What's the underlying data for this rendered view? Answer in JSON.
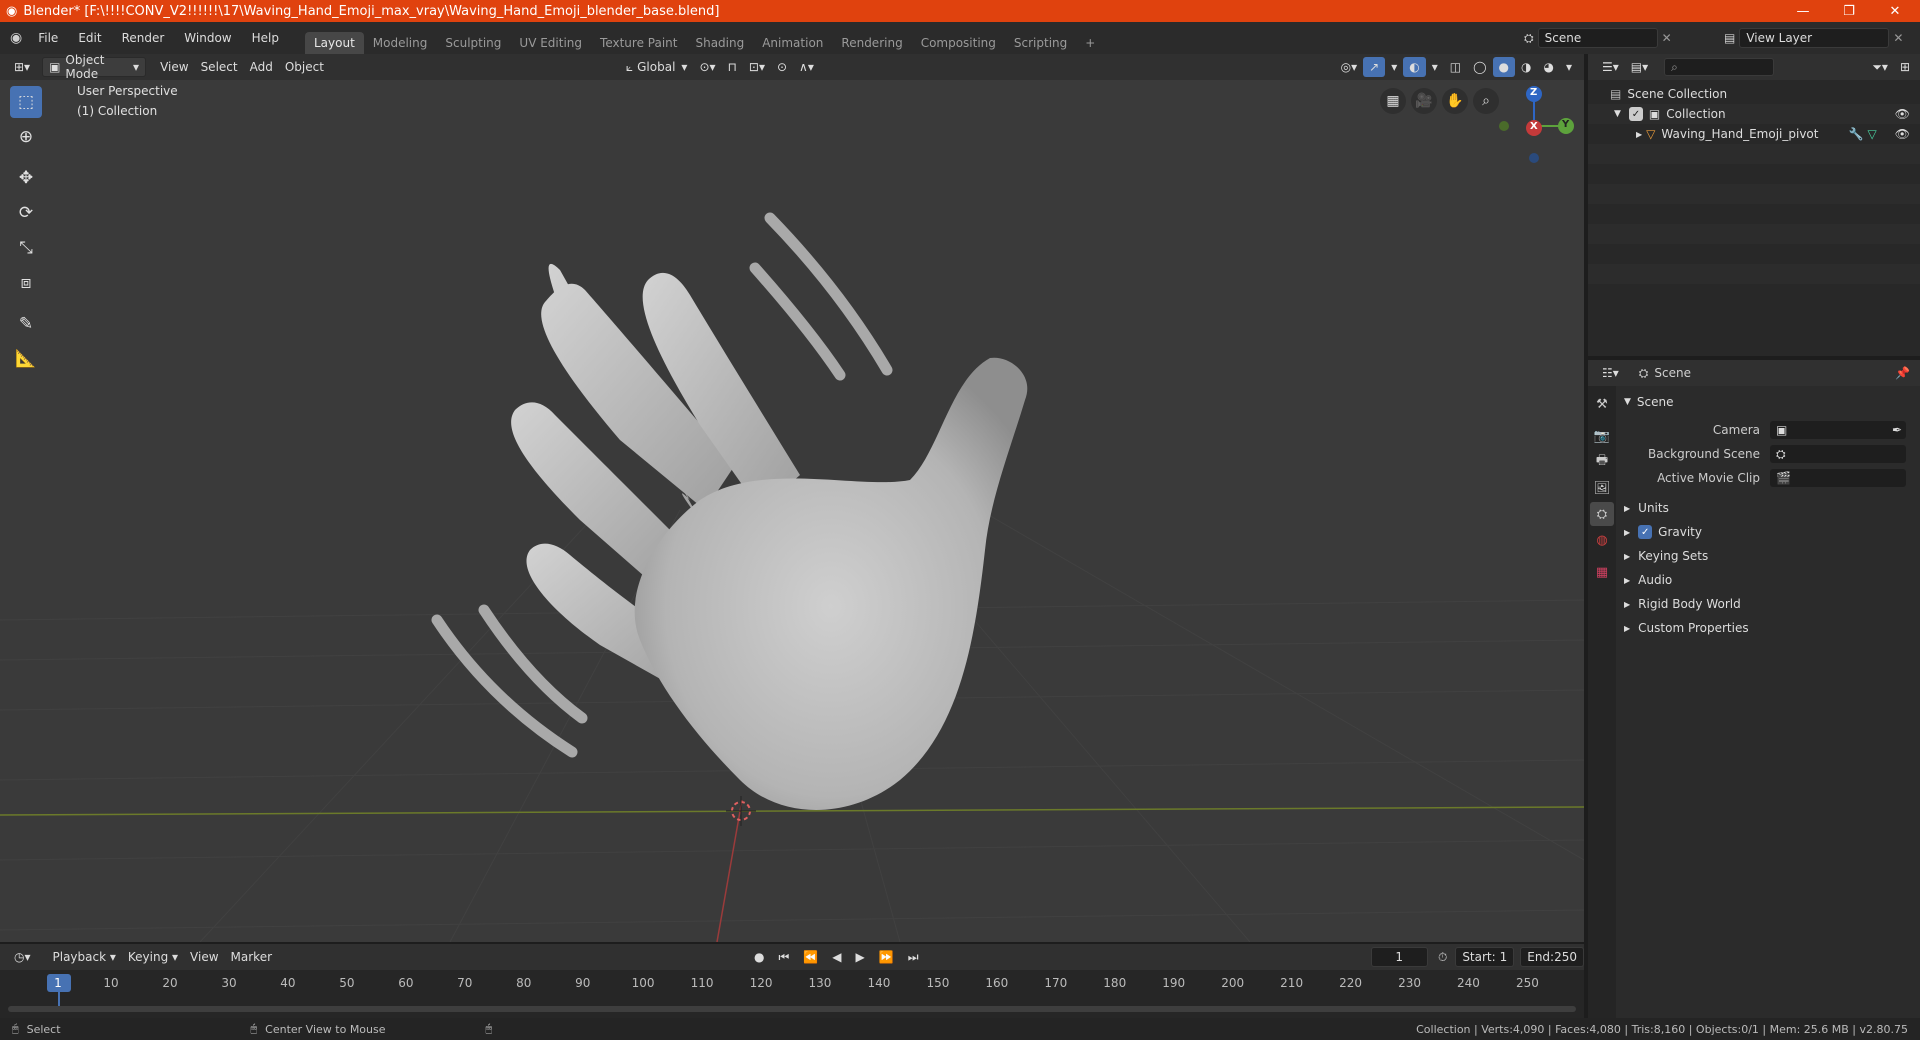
{
  "titlebar": {
    "title": "Blender* [F:\\!!!!CONV_V2!!!!!!\\17\\Waving_Hand_Emoji_max_vray\\Waving_Hand_Emoji_blender_base.blend]",
    "minimize": "—",
    "restore": "❐",
    "close": "✕"
  },
  "menu": [
    "File",
    "Edit",
    "Render",
    "Window",
    "Help"
  ],
  "workspaces": [
    "Layout",
    "Modeling",
    "Sculpting",
    "UV Editing",
    "Texture Paint",
    "Shading",
    "Animation",
    "Rendering",
    "Compositing",
    "Scripting"
  ],
  "workspace_add": "+",
  "scene_field": "Scene",
  "view_layer_field": "View Layer",
  "viewport_header": {
    "mode": "Object Mode",
    "menus": [
      "View",
      "Select",
      "Add",
      "Object"
    ],
    "orientation": "Global"
  },
  "viewport": {
    "perspective_label": "User Perspective",
    "collection_label": "(1) Collection",
    "gizmo": {
      "z": "Z",
      "y": "Y",
      "x": "X"
    }
  },
  "outliner": {
    "search_placeholder": "",
    "items": [
      {
        "label": "Scene Collection"
      },
      {
        "label": "Collection"
      },
      {
        "label": "Waving_Hand_Emoji_pivot"
      }
    ]
  },
  "properties": {
    "header": "Scene",
    "panel": "Scene",
    "fields": [
      {
        "label": "Camera",
        "value": ""
      },
      {
        "label": "Background Scene",
        "value": ""
      },
      {
        "label": "Active Movie Clip",
        "value": ""
      }
    ],
    "sections": [
      "Units",
      "Gravity",
      "Keying Sets",
      "Audio",
      "Rigid Body World",
      "Custom Properties"
    ],
    "gravity_checked": true
  },
  "timeline": {
    "menus": [
      "Playback",
      "Keying",
      "View",
      "Marker"
    ],
    "current_frame": "1",
    "start_label": "Start:",
    "start": "1",
    "end_label": "End:",
    "end": "250",
    "ticks": [
      "1",
      "10",
      "20",
      "30",
      "40",
      "50",
      "60",
      "70",
      "80",
      "90",
      "100",
      "110",
      "120",
      "130",
      "140",
      "150",
      "160",
      "170",
      "180",
      "190",
      "200",
      "210",
      "220",
      "230",
      "240",
      "250"
    ]
  },
  "statusbar": {
    "left": "Select",
    "middle": "Center View to Mouse",
    "right": "Collection | Verts:4,090 | Faces:4,080 | Tris:8,160 | Objects:0/1 | Mem: 25.6 MB | v2.80.75"
  },
  "colors": {
    "accent": "#4772b3",
    "titlebar": "#e0420e",
    "viewport": "#3a3a3a"
  }
}
